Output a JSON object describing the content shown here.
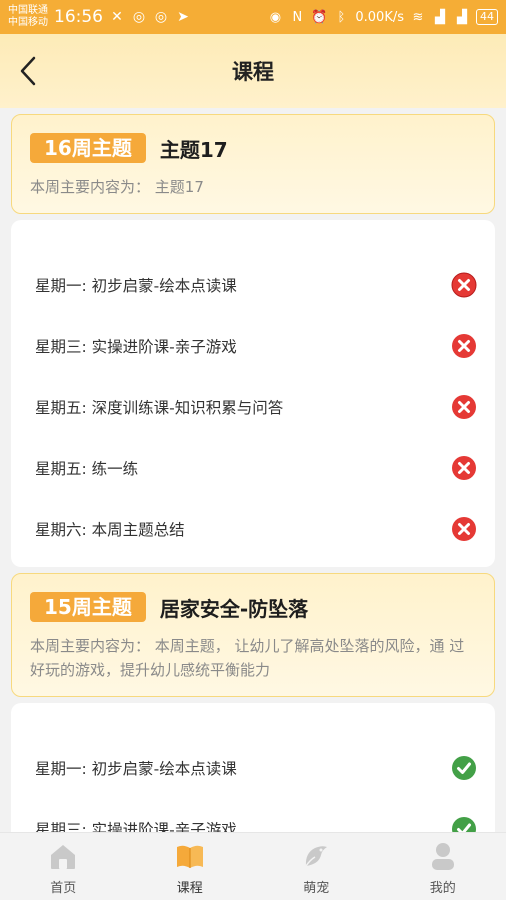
{
  "status_bar": {
    "carrier_1": "中国联通",
    "carrier_2": "中国移动",
    "time": "16:56",
    "speed": "0.00K/s",
    "battery": "44"
  },
  "header": {
    "title": "课程"
  },
  "weeks": [
    {
      "tag": "16周主题",
      "name": "主题17",
      "desc": "本周主要内容为：  主题17",
      "lessons": [
        {
          "title": "星期一: 初步启蒙-绘本点读课",
          "status": "incomplete"
        },
        {
          "title": "星期三: 实操进阶课-亲子游戏",
          "status": "incomplete"
        },
        {
          "title": "星期五: 深度训练课-知识积累与问答",
          "status": "incomplete"
        },
        {
          "title": "星期五: 练一练",
          "status": "incomplete"
        },
        {
          "title": "星期六: 本周主题总结",
          "status": "incomplete"
        }
      ]
    },
    {
      "tag": "15周主题",
      "name": "居家安全-防坠落",
      "desc": "本周主要内容为：  本周主题，  让幼儿了解高处坠落的风险，通 过好玩的游戏，提升幼儿感统平衡能力",
      "lessons": [
        {
          "title": "星期一: 初步启蒙-绘本点读课",
          "status": "complete"
        },
        {
          "title": "星期三: 实操进阶课-亲子游戏",
          "status": "complete"
        }
      ]
    }
  ],
  "bottom_nav": [
    {
      "label": "首页",
      "icon": "home-icon"
    },
    {
      "label": "课程",
      "icon": "book-icon",
      "active": true
    },
    {
      "label": "萌宠",
      "icon": "pet-icon"
    },
    {
      "label": "我的",
      "icon": "profile-icon"
    }
  ],
  "colors": {
    "accent": "#f5a93a",
    "status_bar": "#f5ad36",
    "incomplete": "#e53935",
    "complete": "#43a047"
  }
}
